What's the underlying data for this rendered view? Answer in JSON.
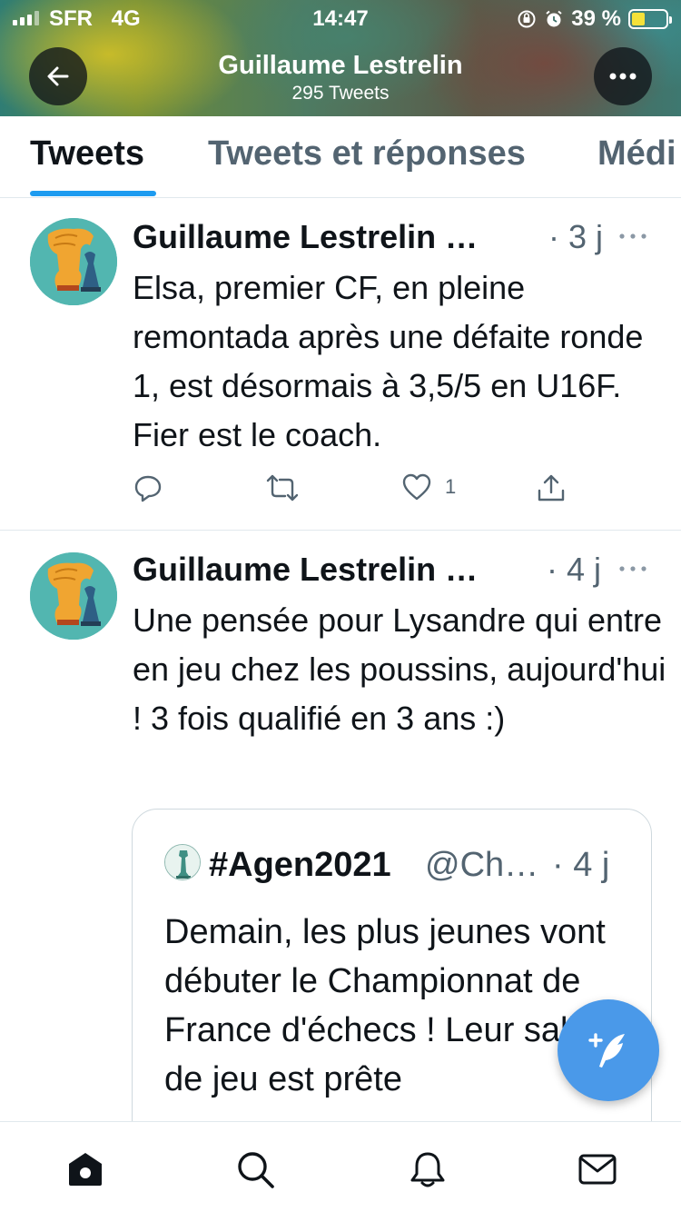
{
  "status_bar": {
    "carrier": "SFR",
    "network": "4G",
    "time": "14:47",
    "battery_percent": "39 %",
    "battery_level": 0.39,
    "icons": [
      "signal-icon",
      "orientation-lock-icon",
      "alarm-icon",
      "battery-charging-icon"
    ]
  },
  "header": {
    "title": "Guillaume Lestrelin",
    "subtitle": "295 Tweets",
    "back_icon": "arrow-left-icon",
    "more_icon": "more-icon"
  },
  "tabs": [
    {
      "label": "Tweets",
      "active": true
    },
    {
      "label": "Tweets et réponses",
      "active": false
    },
    {
      "label": "Médi",
      "active": false
    }
  ],
  "tweets": [
    {
      "author": "Guillaume Lestrelin …",
      "time": "· 3 j",
      "text": "Elsa, premier CF, en pleine remontada après une défaite ronde 1, est désormais à 3,5/5 en U16F. Fier est le coach.",
      "likes": "1"
    },
    {
      "author": "Guillaume Lestrelin …",
      "time": "· 4 j",
      "text": "Une pensée pour Lysandre qui entre en jeu chez les poussins, aujourd'hui ! 3 fois qualifié en 3 ans :)",
      "quote": {
        "name": "#Agen2021",
        "handle": "@Ch…",
        "time": "· 4 j",
        "text": "Demain, les plus jeunes vont débuter le Championnat de France d'échecs ! Leur salle de jeu est prête"
      }
    }
  ],
  "nav": [
    "home-icon",
    "search-icon",
    "notifications-icon",
    "messages-icon"
  ],
  "colors": {
    "accent": "#1d9bf0",
    "fab": "#4a99e9",
    "text": "#0f1419",
    "muted": "#536471"
  }
}
